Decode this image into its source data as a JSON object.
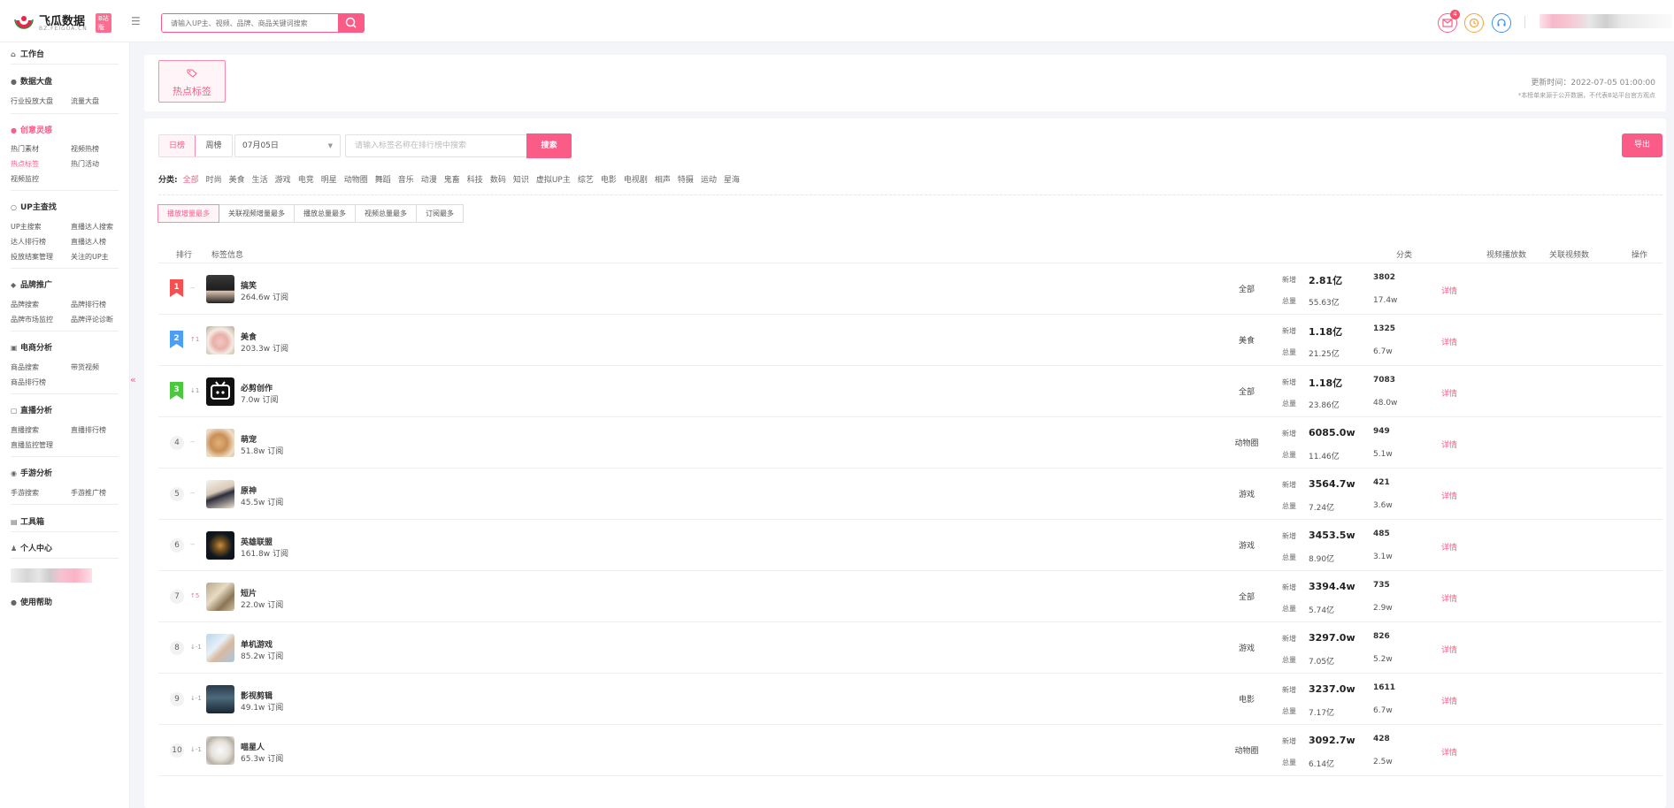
{
  "brand": {
    "name": "飞瓜数据",
    "badge": "B站版",
    "domain": "BZ.FEIGUA.CN"
  },
  "search": {
    "placeholder": "请输入UP主、视频、品牌、商品关键词搜索"
  },
  "notifications": {
    "count": "4"
  },
  "sidebar": {
    "workbench": "工作台",
    "data_board": {
      "title": "数据大盘",
      "items": [
        "行业投放大盘",
        "流量大盘"
      ]
    },
    "creative": {
      "title": "创意灵感",
      "items": [
        "热门素材",
        "视频热榜",
        "热点标签",
        "热门活动",
        "视频监控"
      ]
    },
    "up_search": {
      "title": "UP主查找",
      "items": [
        "UP主搜索",
        "直播达人搜索",
        "达人排行榜",
        "直播达人榜",
        "投放结案管理",
        "关注的UP主"
      ]
    },
    "brand": {
      "title": "品牌推广",
      "items": [
        "品牌搜索",
        "品牌排行榜",
        "品牌市场监控",
        "品牌评论诊断"
      ]
    },
    "ecom": {
      "title": "电商分析",
      "items": [
        "商品搜索",
        "带货视频",
        "商品排行榜"
      ]
    },
    "live": {
      "title": "直播分析",
      "items": [
        "直播搜索",
        "直播排行榜",
        "直播监控管理"
      ]
    },
    "mobile_game": {
      "title": "手游分析",
      "items": [
        "手游搜索",
        "手游推广榜"
      ]
    },
    "toolbox": "工具箱",
    "personal": "个人中心",
    "help": "使用帮助"
  },
  "header_card": {
    "tab": "热点标签",
    "update_time": "更新时间：2022-07-05 01:00:00",
    "note": "*本榜单来源于公开数据，不代表B站平台官方观点"
  },
  "filters": {
    "period": [
      "日榜",
      "周榜"
    ],
    "date": "07月05日",
    "tag_search_placeholder": "请输入标签名称在排行榜中搜索",
    "search_btn": "搜索",
    "export_btn": "导出",
    "category_label": "分类:",
    "categories": [
      "全部",
      "时尚",
      "美食",
      "生活",
      "游戏",
      "电竞",
      "明星",
      "动物圈",
      "舞蹈",
      "音乐",
      "动漫",
      "鬼畜",
      "科技",
      "数码",
      "知识",
      "虚拟UP主",
      "综艺",
      "电影",
      "电视剧",
      "相声",
      "特摄",
      "运动",
      "星海"
    ],
    "sorts": [
      "播放增量最多",
      "关联视频增量最多",
      "播放总量最多",
      "视频总量最多",
      "订阅最多"
    ]
  },
  "table": {
    "headers": {
      "rank": "排行",
      "tag_info": "标签信息",
      "category": "分类",
      "plays": "视频播放数",
      "videos": "关联视频数",
      "action": "操作"
    },
    "label_new": "新增",
    "label_total": "总量",
    "action_label": "详情",
    "rows": [
      {
        "rank": "1",
        "change": "--",
        "name": "搞笑",
        "subs": "264.6w 订阅",
        "category": "全部",
        "play_new": "2.81亿",
        "play_total": "55.63亿",
        "video_new": "3802",
        "video_total": "17.4w"
      },
      {
        "rank": "2",
        "change": "↑1",
        "name": "美食",
        "subs": "203.3w 订阅",
        "category": "美食",
        "play_new": "1.18亿",
        "play_total": "21.25亿",
        "video_new": "1325",
        "video_total": "6.7w"
      },
      {
        "rank": "3",
        "change": "↓1",
        "name": "必剪创作",
        "subs": "7.0w 订阅",
        "category": "全部",
        "play_new": "1.18亿",
        "play_total": "23.86亿",
        "video_new": "7083",
        "video_total": "48.0w"
      },
      {
        "rank": "4",
        "change": "--",
        "name": "萌宠",
        "subs": "51.8w 订阅",
        "category": "动物圈",
        "play_new": "6085.0w",
        "play_total": "11.46亿",
        "video_new": "949",
        "video_total": "5.1w"
      },
      {
        "rank": "5",
        "change": "--",
        "name": "原神",
        "subs": "45.5w 订阅",
        "category": "游戏",
        "play_new": "3564.7w",
        "play_total": "7.24亿",
        "video_new": "421",
        "video_total": "3.6w"
      },
      {
        "rank": "6",
        "change": "--",
        "name": "英雄联盟",
        "subs": "161.8w 订阅",
        "category": "游戏",
        "play_new": "3453.5w",
        "play_total": "8.90亿",
        "video_new": "485",
        "video_total": "3.1w"
      },
      {
        "rank": "7",
        "change": "↑5",
        "name": "短片",
        "subs": "22.0w 订阅",
        "category": "全部",
        "play_new": "3394.4w",
        "play_total": "5.74亿",
        "video_new": "735",
        "video_total": "2.9w"
      },
      {
        "rank": "8",
        "change": "↓-1",
        "name": "单机游戏",
        "subs": "85.2w 订阅",
        "category": "游戏",
        "play_new": "3297.0w",
        "play_total": "7.05亿",
        "video_new": "826",
        "video_total": "5.2w"
      },
      {
        "rank": "9",
        "change": "↓-1",
        "name": "影视剪辑",
        "subs": "49.1w 订阅",
        "category": "电影",
        "play_new": "3237.0w",
        "play_total": "7.17亿",
        "video_new": "1611",
        "video_total": "6.7w"
      },
      {
        "rank": "10",
        "change": "↓-1",
        "name": "喵星人",
        "subs": "65.3w 订阅",
        "category": "动物圈",
        "play_new": "3092.7w",
        "play_total": "6.14亿",
        "video_new": "428",
        "video_total": "2.5w"
      }
    ]
  },
  "colors": {
    "accent": "#fb5b87",
    "rank1": "#f5504f",
    "rank2": "#4d9ff5",
    "rank3": "#4cc83e"
  }
}
